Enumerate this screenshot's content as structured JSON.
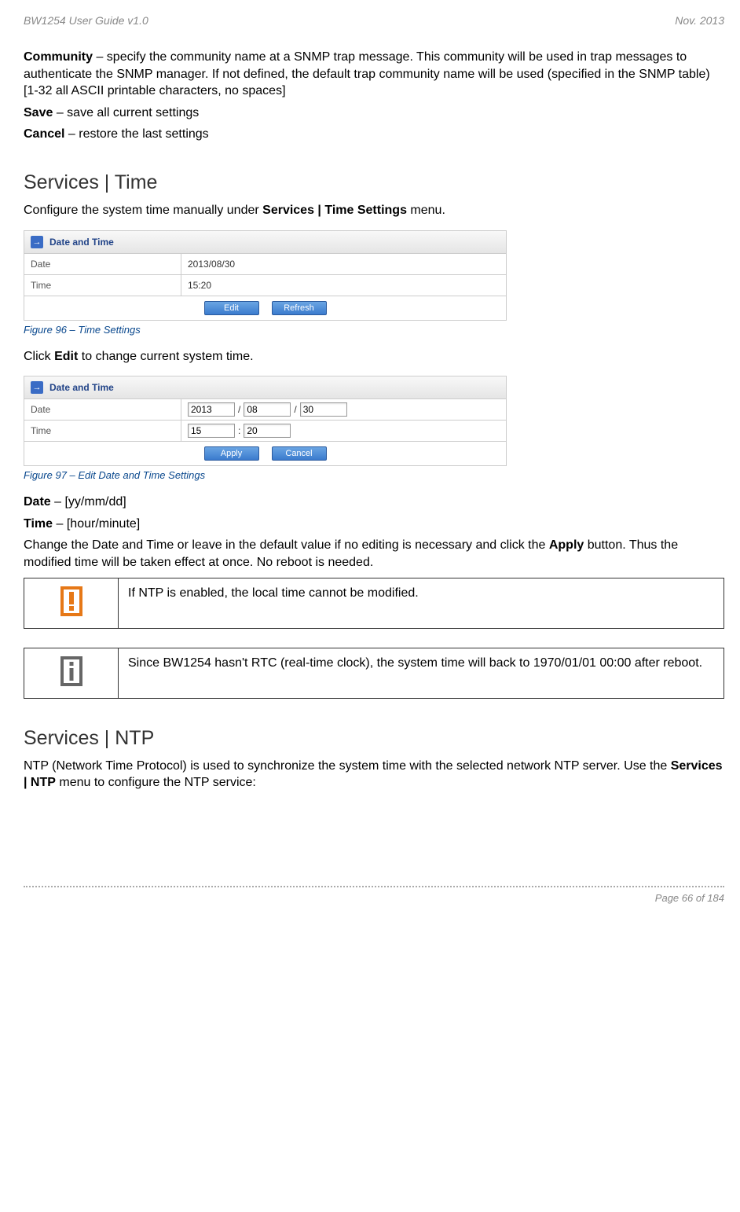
{
  "header": {
    "left": "BW1254 User Guide v1.0",
    "right": "Nov.  2013"
  },
  "intro": {
    "community_label": "Community",
    "community_text": " – specify the community name at a SNMP trap message. This community will be used in trap messages to authenticate the SNMP manager. If not defined, the default trap community name will be used (specified in the SNMP table) [1-32 all ASCII printable characters, no spaces]",
    "save_label": "Save",
    "save_text": " – save all current settings",
    "cancel_label": "Cancel",
    "cancel_text": " – restore the last settings"
  },
  "time_section": {
    "heading": "Services | Time",
    "desc_pre": "Configure the system time manually under ",
    "desc_bold": "Services | Time Settings",
    "desc_post": " menu.",
    "panel_title": "Date and Time",
    "date_label": "Date",
    "date_value": "2013/08/30",
    "time_label": "Time",
    "time_value": "15:20",
    "btn_edit": "Edit",
    "btn_refresh": "Refresh",
    "fig_caption": "Figure 96 – Time Settings",
    "click_edit_pre": "Click ",
    "click_edit_bold": "Edit",
    "click_edit_post": " to change current system time."
  },
  "edit_section": {
    "panel_title": "Date and Time",
    "date_label": "Date",
    "date_yyyy": "2013",
    "date_mm": "08",
    "date_dd": "30",
    "slash": "/",
    "colon": ":",
    "time_label": "Time",
    "time_hh": "15",
    "time_min": "20",
    "btn_apply": "Apply",
    "btn_cancel": "Cancel",
    "fig_caption": "Figure 97 – Edit Date and Time Settings",
    "date_line_label": "Date",
    "date_line_text": " – [yy/mm/dd]",
    "time_line_label": "Time",
    "time_line_text": " – [hour/minute]",
    "change_pre": "Change the Date and Time or leave in the default value if no editing is necessary and click the ",
    "change_bold": "Apply",
    "change_post": " button. Thus the modified time will be taken effect at once. No reboot is needed.",
    "warn_text": "If NTP is enabled, the local time cannot be modified.",
    "info_text": "Since BW1254 hasn't RTC (real-time clock), the system time will back to 1970/01/01 00:00 after reboot."
  },
  "ntp_section": {
    "heading": "Services | NTP",
    "desc_pre": "NTP (Network Time Protocol) is used to synchronize the system time with the selected network NTP server. Use the ",
    "desc_bold": "Services | NTP",
    "desc_post": " menu to configure the NTP service:"
  },
  "footer": "Page 66 of 184"
}
